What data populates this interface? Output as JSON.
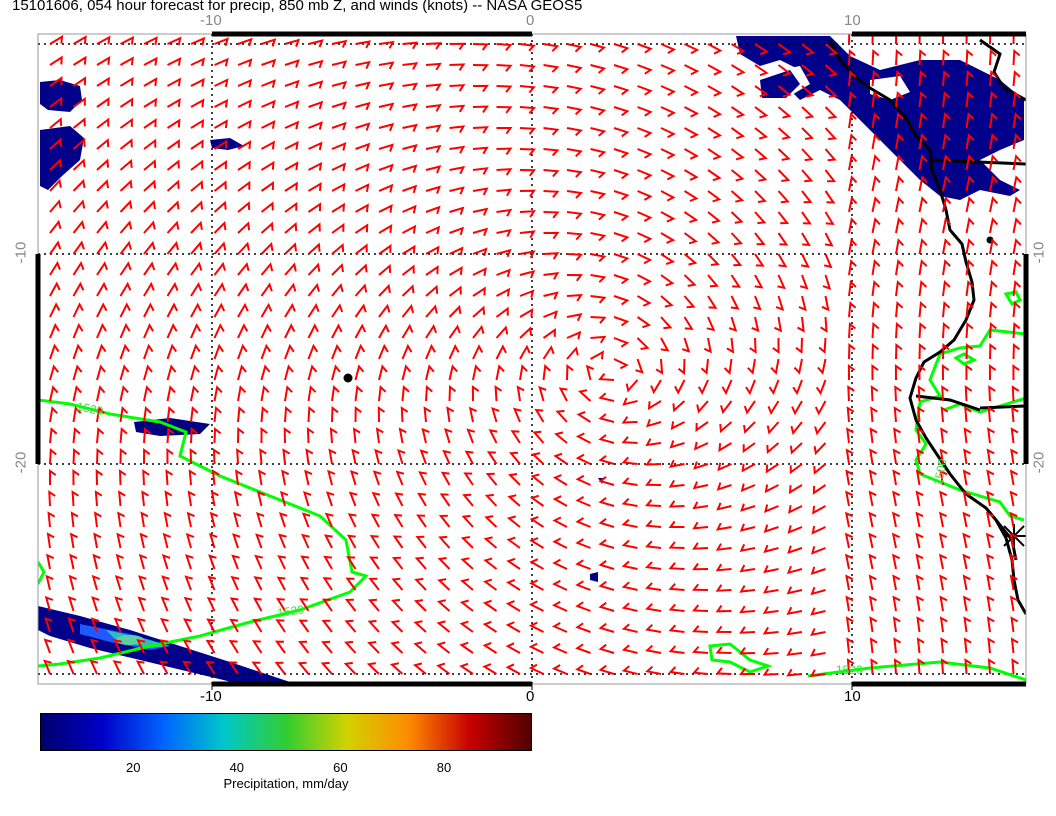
{
  "title": "15101606, 054 hour forecast for precip, 850 mb Z, and winds (knots) -- NASA GEOS5",
  "map": {
    "lon_range": [
      -15.5,
      15.5
    ],
    "lat_range": [
      -30,
      0.3
    ],
    "top_lon_ticks": [
      "-10",
      "0",
      "10"
    ],
    "bottom_lon_ticks": [
      "-10",
      "0",
      "10"
    ],
    "left_lat_ticks": [
      "-10",
      "-20"
    ],
    "right_lat_ticks": [
      "-10",
      "-20"
    ],
    "contour_labels": [
      "1520",
      "1520",
      "1520",
      "1500"
    ],
    "wind_barb_color": "#ff0000",
    "contour_color": "#00ff00",
    "coastline_color": "#000000",
    "precip_color_low": "#00008b"
  },
  "colorbar": {
    "label": "Precipitation, mm/day",
    "ticks": [
      "20",
      "40",
      "60",
      "80"
    ],
    "tick_values": [
      20,
      40,
      60,
      80
    ],
    "range": [
      2,
      97
    ],
    "colors": [
      "#00006b",
      "#0000c8",
      "#0064ff",
      "#00c8c8",
      "#32cd32",
      "#d2d200",
      "#ff8c00",
      "#c80000",
      "#500000"
    ]
  }
}
